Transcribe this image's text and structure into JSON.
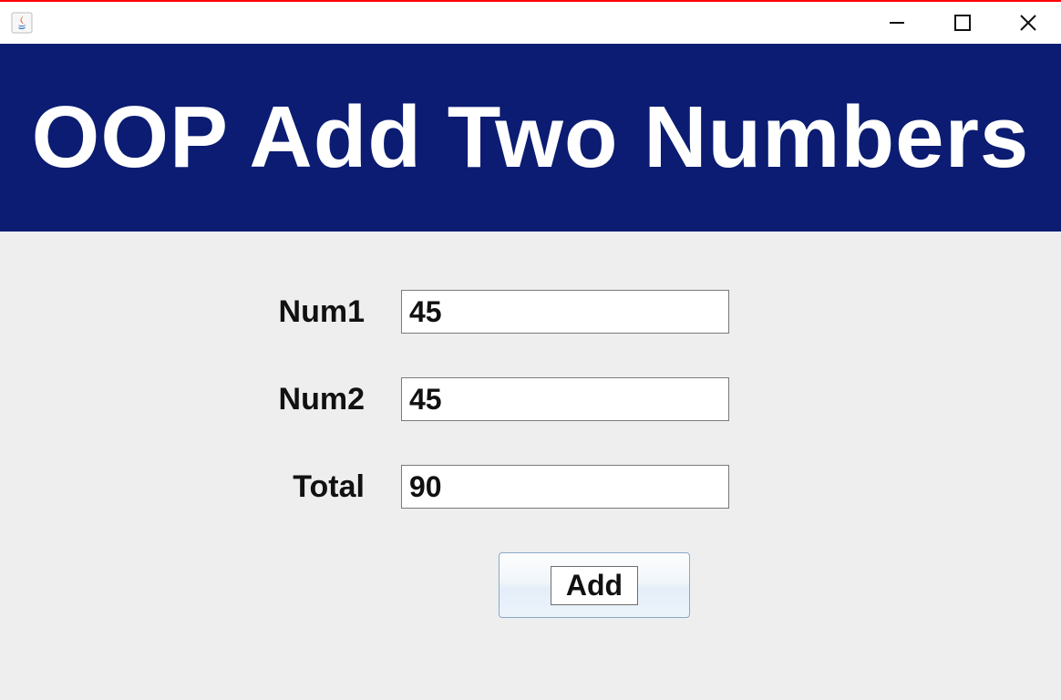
{
  "window": {
    "title": ""
  },
  "banner": {
    "heading": "OOP Add Two Numbers"
  },
  "form": {
    "num1": {
      "label": "Num1",
      "value": "45"
    },
    "num2": {
      "label": "Num2",
      "value": "45"
    },
    "total": {
      "label": "Total",
      "value": "90"
    }
  },
  "buttons": {
    "add": "Add"
  },
  "colors": {
    "banner_bg": "#0b1c72",
    "content_bg": "#eeeeee",
    "accent_red": "#ff0000"
  }
}
